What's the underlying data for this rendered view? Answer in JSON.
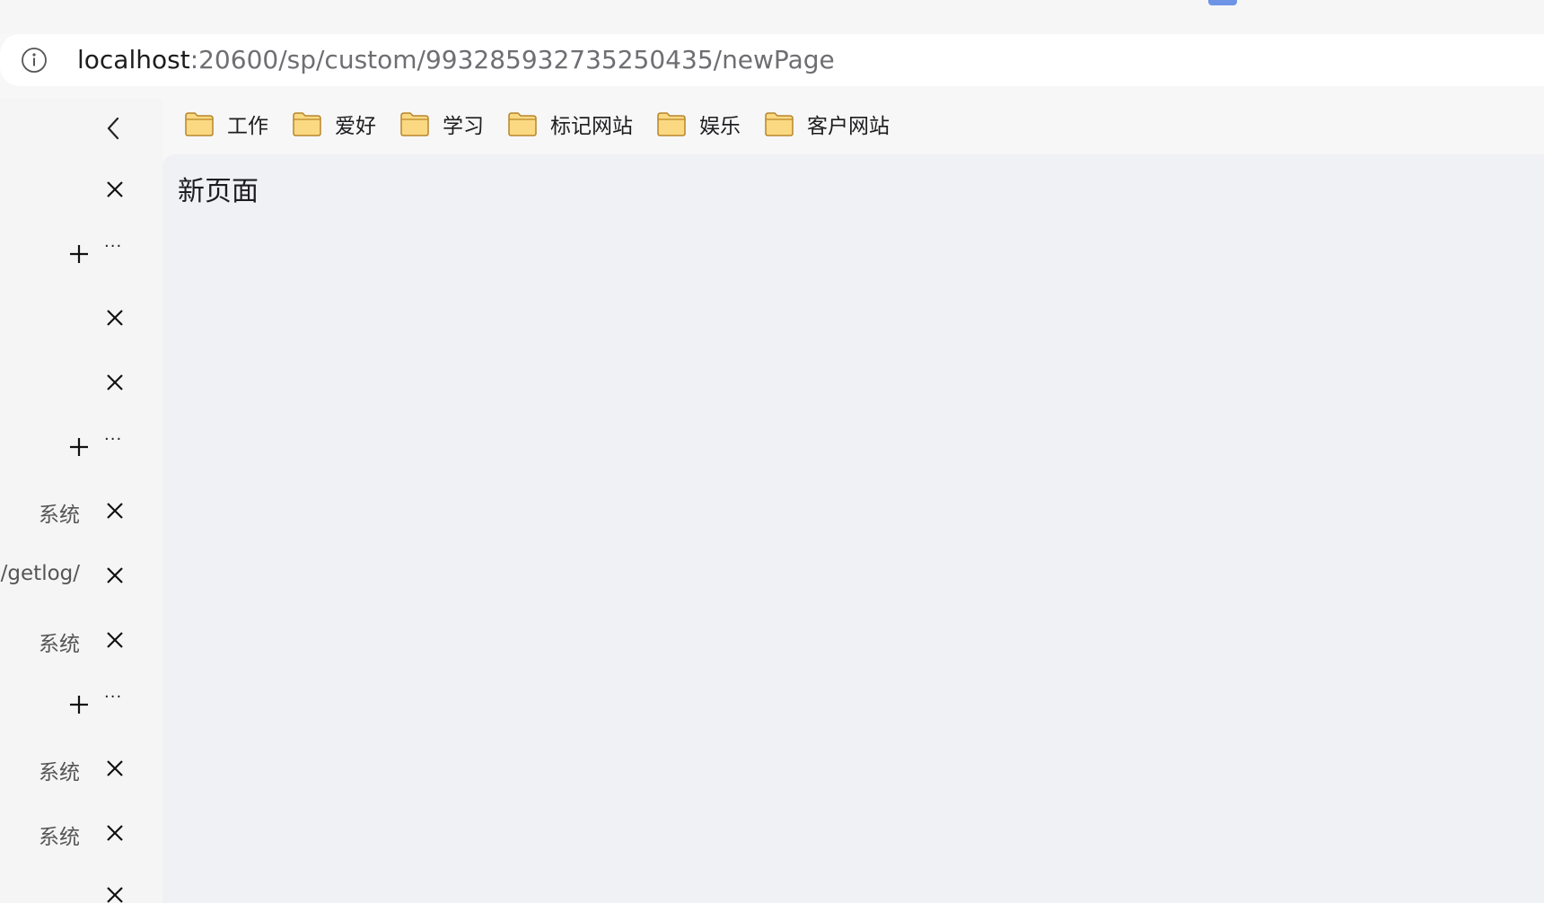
{
  "address_bar": {
    "url_host": "localhost",
    "url_path": ":20600/sp/custom/993285932735250435/newPage"
  },
  "bookmarks": [
    {
      "label": "工作",
      "icon": "folder-icon"
    },
    {
      "label": "爱好",
      "icon": "folder-icon"
    },
    {
      "label": "学习",
      "icon": "folder-icon"
    },
    {
      "label": "标记网站",
      "icon": "folder-icon"
    },
    {
      "label": "娱乐",
      "icon": "folder-icon"
    },
    {
      "label": "客户网站",
      "icon": "folder-icon"
    }
  ],
  "sidebar": {
    "rows": [
      {
        "label": "",
        "action": "close"
      },
      {
        "label": "",
        "action": "add-more"
      },
      {
        "label": "",
        "action": "close"
      },
      {
        "label": "",
        "action": "close"
      },
      {
        "label": "",
        "action": "add-more"
      },
      {
        "label": "系统",
        "action": "close"
      },
      {
        "label": "/getlog/",
        "action": "close"
      },
      {
        "label": "系统",
        "action": "close"
      },
      {
        "label": "",
        "action": "add-more"
      },
      {
        "label": "系统",
        "action": "close"
      },
      {
        "label": "系统",
        "action": "close"
      },
      {
        "label": "",
        "action": "close"
      }
    ]
  },
  "main": {
    "title": "新页面"
  },
  "colors": {
    "folder_fill": "#fbd982",
    "folder_stroke": "#b8862a",
    "content_bg": "#f0f1f4"
  }
}
